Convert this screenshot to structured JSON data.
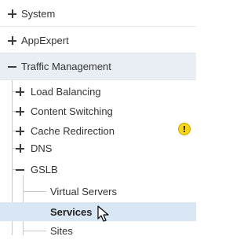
{
  "tree": {
    "top_items": [
      {
        "label": "System",
        "state": "collapsed"
      },
      {
        "label": "AppExpert",
        "state": "collapsed"
      },
      {
        "label": "Traffic Management",
        "state": "expanded"
      }
    ],
    "traffic_children": [
      {
        "label": "Load Balancing",
        "state": "collapsed"
      },
      {
        "label": "Content Switching",
        "state": "collapsed"
      },
      {
        "label": "Cache Redirection",
        "state": "collapsed",
        "warning": true
      },
      {
        "label": "DNS",
        "state": "collapsed"
      },
      {
        "label": "GSLB",
        "state": "expanded"
      }
    ],
    "gslb_children": [
      {
        "label": "Virtual Servers"
      },
      {
        "label": "Services",
        "selected": true
      },
      {
        "label": "Sites"
      }
    ],
    "warning_glyph": "!"
  },
  "colors": {
    "selected_bg": "#d9e7f5",
    "expanded_bg": "#e8eef4",
    "warning": "#f6d51a"
  },
  "icons": {
    "expand": "plus-icon",
    "collapse": "minus-icon",
    "warning": "warning-icon",
    "cursor": "mouse-pointer-icon"
  }
}
